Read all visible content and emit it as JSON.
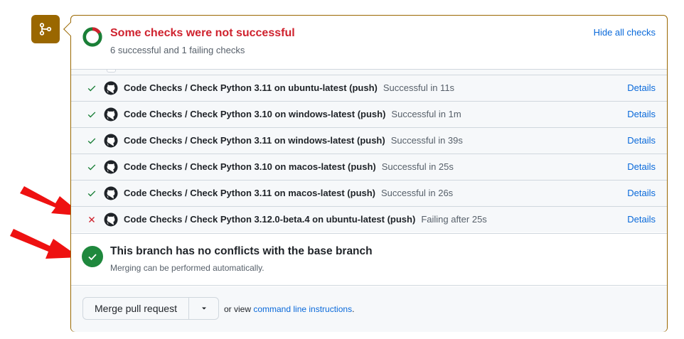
{
  "summary": {
    "title": "Some checks were not successful",
    "subtitle": "6 successful and 1 failing checks",
    "toggle_label": "Hide all checks",
    "successful_count": 6,
    "failing_count": 1
  },
  "checks": [
    {
      "status": "success",
      "workflow": "Code Checks",
      "separator": " / ",
      "job": "Check Python 3.11 on ubuntu-latest (push)",
      "result": "Successful in 11s",
      "details_label": "Details"
    },
    {
      "status": "success",
      "workflow": "Code Checks",
      "separator": " / ",
      "job": "Check Python 3.10 on windows-latest (push)",
      "result": "Successful in 1m",
      "details_label": "Details"
    },
    {
      "status": "success",
      "workflow": "Code Checks",
      "separator": " / ",
      "job": "Check Python 3.11 on windows-latest (push)",
      "result": "Successful in 39s",
      "details_label": "Details"
    },
    {
      "status": "success",
      "workflow": "Code Checks",
      "separator": " / ",
      "job": "Check Python 3.10 on macos-latest (push)",
      "result": "Successful in 25s",
      "details_label": "Details"
    },
    {
      "status": "success",
      "workflow": "Code Checks",
      "separator": " / ",
      "job": "Check Python 3.11 on macos-latest (push)",
      "result": "Successful in 26s",
      "details_label": "Details"
    },
    {
      "status": "failure",
      "workflow": "Code Checks",
      "separator": " / ",
      "job": "Check Python 3.12.0-beta.4 on ubuntu-latest (push)",
      "result": "Failing after 25s",
      "details_label": "Details"
    }
  ],
  "merge_status": {
    "title": "This branch has no conflicts with the base branch",
    "subtitle": "Merging can be performed automatically."
  },
  "merge_actions": {
    "button_label": "Merge pull request",
    "alt_prefix": "or view ",
    "alt_link": "command line instructions",
    "alt_suffix": "."
  },
  "colors": {
    "success": "#1a7f37",
    "failure": "#cf222e",
    "link": "#0969da",
    "merge_badge": "#9a6700",
    "annotation_arrow": "#ee1111"
  },
  "icons": {
    "merge_badge": "git-branch-icon",
    "success": "check-icon",
    "failure": "x-icon",
    "provider": "github-icon",
    "dropdown": "triangle-down-icon"
  }
}
